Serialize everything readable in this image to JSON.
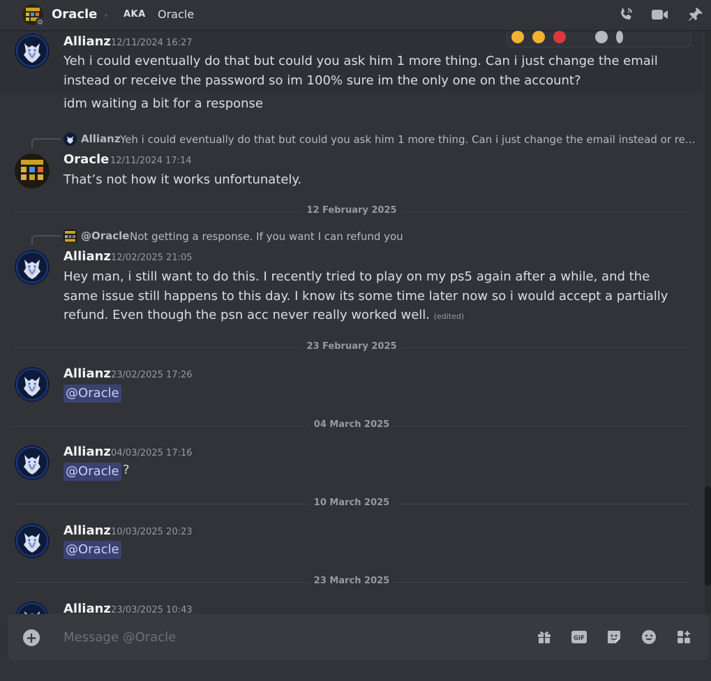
{
  "header": {
    "title": "Oracle",
    "aka_label": "AKA",
    "nickname": "Oracle"
  },
  "messages": [
    {
      "author": "Allianz",
      "timestamp": "12/11/2024 16:27",
      "text": "Yeh i could eventually do that but could you ask him 1 more thing.  Can i just change the email instead or receive the password so im 100% sure im the only one on the account?"
    },
    {
      "text": "idm waiting a bit for a response"
    },
    {
      "reply": {
        "author": "Allianz",
        "text": "Yeh i could eventually do that but could you ask him 1 more thing.  Can i just change the email instead or re..."
      },
      "author": "Oracle",
      "timestamp": "12/11/2024 17:14",
      "text": "That’s not how it works unfortunately."
    },
    {
      "reply": {
        "author": "@Oracle",
        "text": "Not getting a response. If you want I can refund you"
      },
      "author": "Allianz",
      "timestamp": "12/02/2025 21:05",
      "text": "Hey man, i still want to do this.  I recently tried to play on my ps5 again after a while, and the same issue still happens to this day. I know its some time later now so i would accept a partially refund. Even though the psn acc never really worked well.",
      "edited": "(edited)"
    },
    {
      "author": "Allianz",
      "timestamp": "23/02/2025 17:26",
      "mention": "@Oracle"
    },
    {
      "author": "Allianz",
      "timestamp": "04/03/2025 17:16",
      "mention": "@Oracle",
      "after": "?"
    },
    {
      "author": "Allianz",
      "timestamp": "10/03/2025 20:23",
      "mention": "@Oracle"
    },
    {
      "author": "Allianz",
      "timestamp": "23/03/2025 10:43"
    }
  ],
  "dividers": [
    "12 February 2025",
    "23 February 2025",
    "04 March 2025",
    "10 March 2025",
    "23 March 2025"
  ],
  "composer": {
    "placeholder": "Message @Oracle",
    "gif_label": "GIF"
  },
  "colors": {
    "background": "#313338",
    "mention_bg": "#3c4270",
    "mention_text": "#c9cdfb",
    "composer_bg": "#383a40"
  },
  "icons": [
    "phone-call-icon",
    "video-call-icon",
    "pin-icon",
    "plus-icon",
    "gift-icon",
    "gif-icon",
    "sticker-icon",
    "emoji-icon",
    "apps-icon"
  ]
}
